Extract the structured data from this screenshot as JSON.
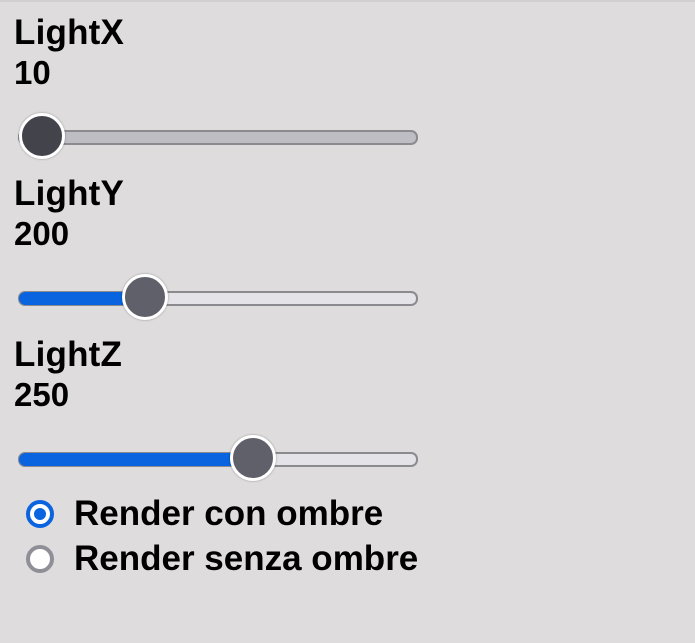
{
  "colors": {
    "accent": "#0a64e0",
    "background": "#dedcdd",
    "thumb": "#60606a"
  },
  "sliders": [
    {
      "label": "LightX",
      "value": "10",
      "fraction": 0.06
    },
    {
      "label": "LightY",
      "value": "200",
      "fraction": 0.32
    },
    {
      "label": "LightZ",
      "value": "250",
      "fraction": 0.59
    }
  ],
  "render_options": {
    "selected": 0,
    "items": [
      {
        "label": "Render con ombre"
      },
      {
        "label": "Render senza ombre"
      }
    ]
  }
}
